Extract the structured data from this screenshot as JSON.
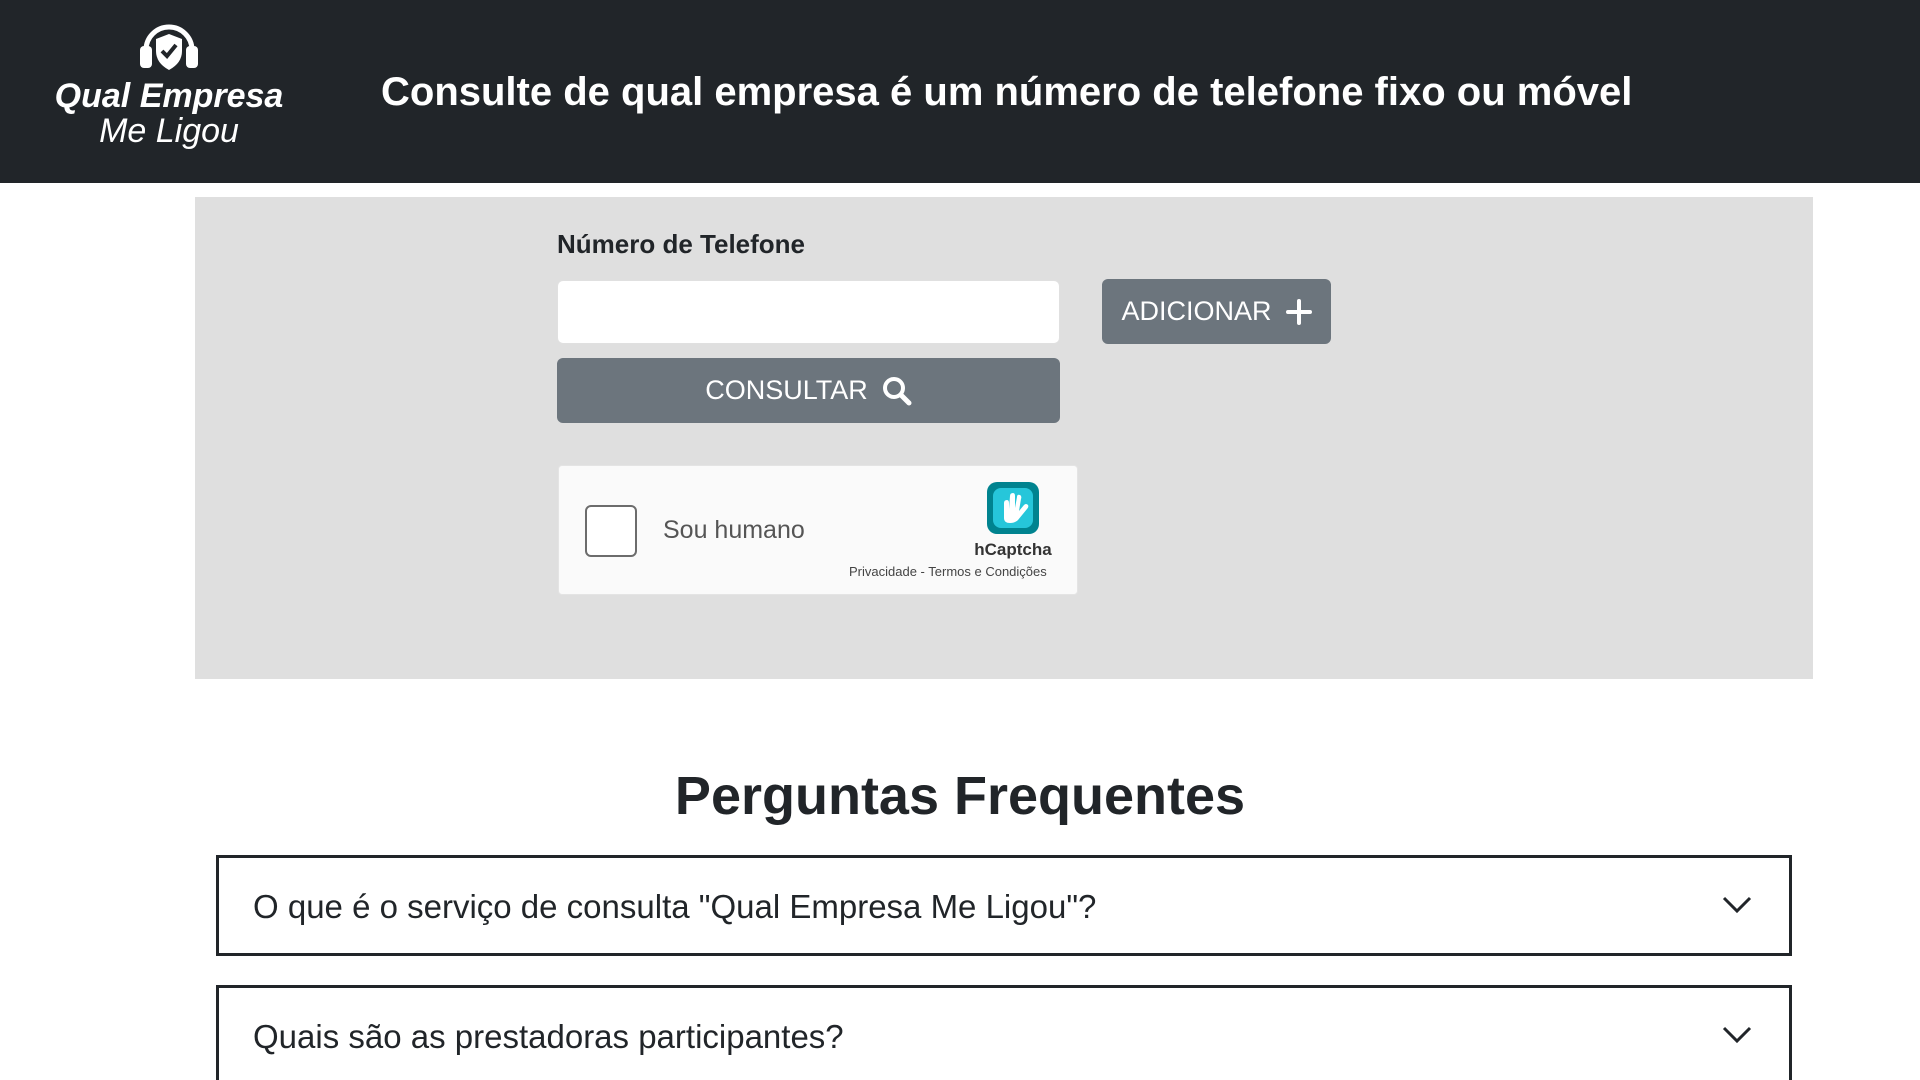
{
  "header": {
    "logo_line1": "Qual Empresa",
    "logo_line2": "Me Ligou",
    "logo_icon": "headset-shield-icon",
    "headline": "Consulte de qual empresa é um número de telefone fixo ou móvel"
  },
  "form": {
    "phone_label": "Número de Telefone",
    "phone_value": "",
    "add_label": "ADICIONAR",
    "add_icon": "plus-icon",
    "consult_label": "CONSULTAR",
    "consult_icon": "search-icon",
    "button_color": "#6c757d",
    "panel_color": "#dfdfdf"
  },
  "captcha": {
    "checkbox_label": "Sou humano",
    "brand": "hCaptcha",
    "privacy": "Privacidade",
    "separator": " - ",
    "terms": "Termos e Condições",
    "brand_color": "#0074bf",
    "accent_color": "#00838f"
  },
  "faq": {
    "title": "Perguntas Frequentes",
    "items": [
      {
        "question": "O que é o serviço de consulta \"Qual Empresa Me Ligou\"?",
        "expanded": false
      },
      {
        "question": "Quais são as prestadoras participantes?",
        "expanded": false
      }
    ]
  },
  "colors": {
    "header_bg": "#212529",
    "text_dark": "#212529"
  }
}
